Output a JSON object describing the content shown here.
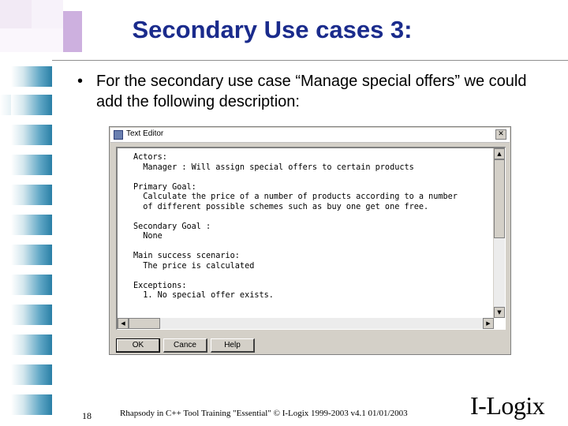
{
  "slide": {
    "title": "Secondary Use cases 3:",
    "bullet_marker": "•",
    "bullet_text": "For the secondary use case “Manage special offers” we could add the following description:"
  },
  "dialog": {
    "title": "Text Editor",
    "close_glyph": "✕",
    "editor_text": "Actors:\n  Manager : Will assign special offers to certain products\n\nPrimary Goal:\n  Calculate the price of a number of products according to a number\n  of different possible schemes such as buy one get one free.\n\nSecondary Goal :\n  None\n\nMain success scenario:\n  The price is calculated\n\nExceptions:\n  1. No special offer exists.",
    "buttons": {
      "ok": "OK",
      "cancel": "Cance",
      "help": "Help"
    },
    "icons": {
      "title_icon": "text-editor-icon",
      "up_arrow": "▲",
      "down_arrow": "▼",
      "left_arrow": "◀",
      "right_arrow": "▶"
    }
  },
  "footer": {
    "page_number": "18",
    "text": "Rhapsody in C++ Tool Training \"Essential\"  © I-Logix 1999-2003   v4.1  01/01/2003",
    "logo": "I-Logix"
  },
  "colors": {
    "title": "#1a2b8c",
    "accent_purple": "#cdb0df",
    "stripe_blue": "#2a7fa6",
    "dialog_face": "#d4d0c8"
  }
}
